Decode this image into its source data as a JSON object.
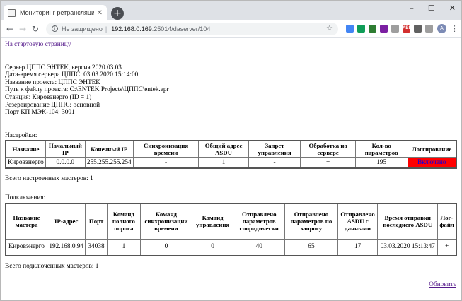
{
  "browser": {
    "tab_title": "Мониторинг ретрансляции дан",
    "new_tab": "+",
    "url_security": "Не защищено",
    "url_host": "192.168.0.169",
    "url_path": ":25014/daserver/104",
    "avatar_letter": "A",
    "extensions": [
      {
        "color": "#4285f4",
        "label": ""
      },
      {
        "color": "#0f9d58",
        "label": ""
      },
      {
        "color": "#2e7d32",
        "label": ""
      },
      {
        "color": "#7b1fa2",
        "label": ""
      },
      {
        "color": "#9e9e9e",
        "label": ""
      },
      {
        "color": "#d32f2f",
        "label": "ABP"
      },
      {
        "color": "#616161",
        "label": ""
      },
      {
        "color": "#9e9e9e",
        "label": ""
      }
    ]
  },
  "page": {
    "home_link": "На стартовую страницу",
    "info_lines": [
      "Сервер ЦППС ЭНТЕК, версия 2020.03.03",
      "Дата-время сервера ЦППС: 03.03.2020 15:14:00",
      "Название проекта: ЦППС ЭНТЕК",
      "Путь к файлу проекта: C:\\ENTEK Projects\\ЦППС\\entek.epr",
      "Станция: Кировэнерго (ID = 1)",
      "Резервирование ЦППС: основной",
      "Порт КП МЭК-104: 3001"
    ],
    "settings_title": "Настройки:",
    "settings_headers": [
      "Название",
      "Начальный IP",
      "Конечный IP",
      "Синхронизация времени",
      "Общий адрес ASDU",
      "Запрет управления",
      "Обработка на сервере",
      "Кол-во параметров",
      "Логгирование"
    ],
    "settings_row": [
      "Кировэнерго",
      "0.0.0.0",
      "255.255.255.254",
      "-",
      "1",
      "-",
      "+",
      "195"
    ],
    "settings_logging": "Включено",
    "masters_configured": "Всего настроенных мастеров: 1",
    "connections_title": "Подключения:",
    "connections_headers": [
      "Название мастера",
      "IP-адрес",
      "Порт",
      "Команд полного опроса",
      "Команд синхронизации времени",
      "Команд управления",
      "Отправлено параметров спорадически",
      "Отправлено параметров по запросу",
      "Отправлено ASDU с данными",
      "Время отправки последнего ASDU",
      "Лог-файл"
    ],
    "connections_row": [
      "Кировэнерго",
      "192.168.0.94",
      "34038",
      "1",
      "0",
      "0",
      "40",
      "65",
      "17",
      "03.03.2020 15:13:47",
      "+"
    ],
    "masters_connected": "Всего подключенных мастеров: 1",
    "refresh_link": "Обновить"
  }
}
